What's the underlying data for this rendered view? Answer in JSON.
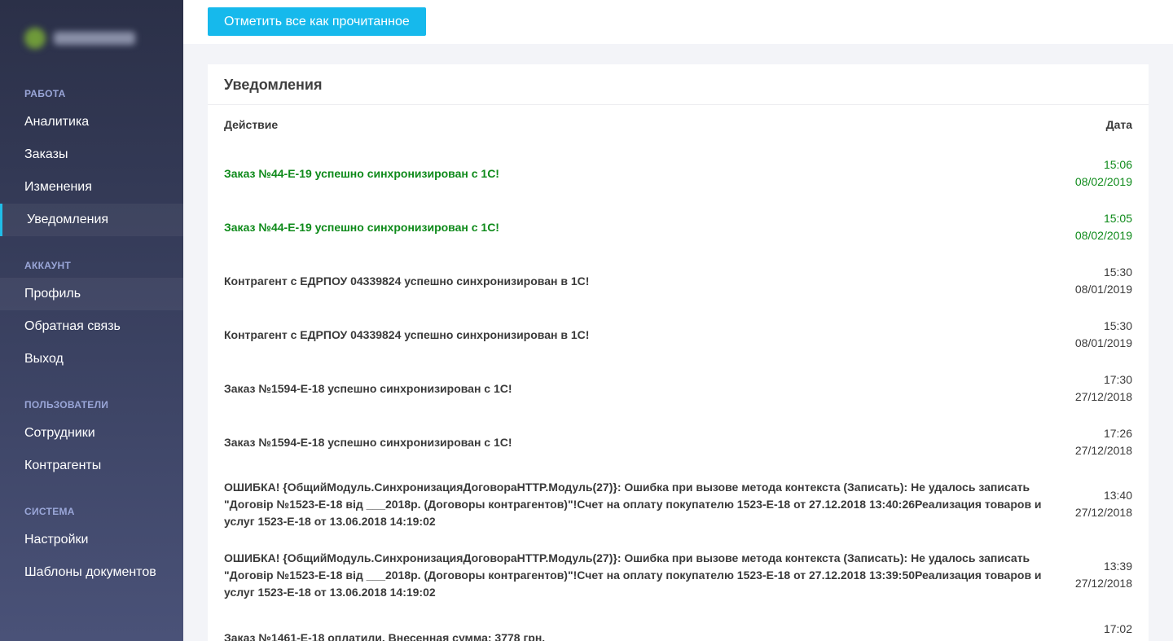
{
  "sidebar": {
    "sections": [
      {
        "heading": "РАБОТА",
        "items": [
          "Аналитика",
          "Заказы",
          "Изменения",
          "Уведомления"
        ]
      },
      {
        "heading": "АККАУНТ",
        "items": [
          "Профиль",
          "Обратная связь",
          "Выход"
        ]
      },
      {
        "heading": "ПОЛЬЗОВАТЕЛИ",
        "items": [
          "Сотрудники",
          "Контрагенты"
        ]
      },
      {
        "heading": "СИСТЕМА",
        "items": [
          "Настройки",
          "Шаблоны документов"
        ]
      }
    ]
  },
  "toolbar": {
    "mark_all_read_label": "Отметить все как прочитанное"
  },
  "card": {
    "title": "Уведомления",
    "col_action": "Действие",
    "col_date": "Дата"
  },
  "notifications": [
    {
      "text": "Заказ №44-Е-19 успешно синхронизирован с 1С!",
      "time": "15:06",
      "date": "08/02/2019",
      "status": "success"
    },
    {
      "text": "Заказ №44-Е-19 успешно синхронизирован с 1С!",
      "time": "15:05",
      "date": "08/02/2019",
      "status": "success"
    },
    {
      "text": "Контрагент с ЕДРПОУ 04339824 успешно синхронизирован в 1С!",
      "time": "15:30",
      "date": "08/01/2019",
      "status": "normal"
    },
    {
      "text": "Контрагент с ЕДРПОУ 04339824 успешно синхронизирован в 1С!",
      "time": "15:30",
      "date": "08/01/2019",
      "status": "normal"
    },
    {
      "text": "Заказ №1594-Е-18 успешно синхронизирован с 1С!",
      "time": "17:30",
      "date": "27/12/2018",
      "status": "normal"
    },
    {
      "text": "Заказ №1594-Е-18 успешно синхронизирован с 1С!",
      "time": "17:26",
      "date": "27/12/2018",
      "status": "normal"
    },
    {
      "text": "ОШИБКА! {ОбщийМодуль.СинхронизацияДоговораHTTP.Модуль(27)}: Ошибка при вызове метода контекста (Записать): Не удалось записать \"Договір №1523-Е-18 від ___2018р. (Договоры контрагентов)\"!Счет на оплату покупателю 1523-Е-18 от 27.12.2018 13:40:26Реализация товаров и услуг 1523-Е-18 от 13.06.2018 14:19:02",
      "time": "13:40",
      "date": "27/12/2018",
      "status": "normal"
    },
    {
      "text": "ОШИБКА! {ОбщийМодуль.СинхронизацияДоговораHTTP.Модуль(27)}: Ошибка при вызове метода контекста (Записать): Не удалось записать \"Договір №1523-Е-18 від ___2018р. (Договоры контрагентов)\"!Счет на оплату покупателю 1523-Е-18 от 27.12.2018 13:39:50Реализация товаров и услуг 1523-Е-18 от 13.06.2018 14:19:02",
      "time": "13:39",
      "date": "27/12/2018",
      "status": "normal"
    },
    {
      "text": "Заказ №1461-Е-18 оплатили. Внесенная сумма: 3778 грн.",
      "time": "17:02",
      "date": "",
      "status": "normal"
    }
  ],
  "colors": {
    "accent": "#16b9ec",
    "success": "#0e8a1a",
    "sidebar_top": "#2b3048",
    "sidebar_bottom": "#4a5278"
  }
}
